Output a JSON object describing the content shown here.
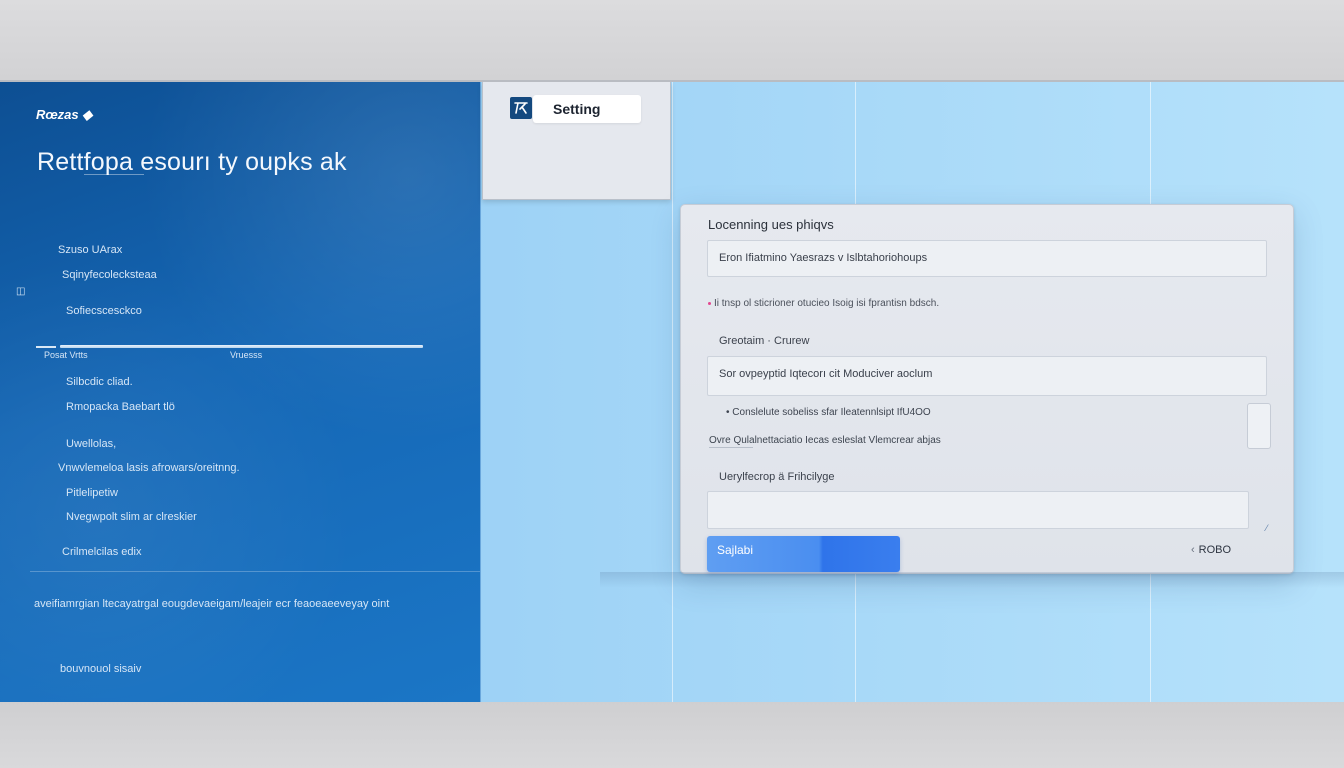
{
  "sidebar": {
    "brand": "Rœzas ◆",
    "title": "Rettfopa esourı ty oupks ak",
    "small_icon": "◫",
    "items_top": [
      "Szuso UArax",
      "Sqinyfecolecksteaa",
      "Sofiecscesckco"
    ],
    "divider_left_label": "Posat  Vrtts",
    "divider_right_label": "Vruesss",
    "items_mid": [
      "Silbcdic cliad.",
      "Rmopacka  Baebart tlö"
    ],
    "items_low": [
      "Uwellolas,",
      "Vnwvlemeloa lasis afrowars/oreitnng.",
      "Pitlelipetiw",
      "Nvegwpolt  slim ar  clreskier"
    ],
    "item_last": "Crilmelcilas edix",
    "footnote": "aveifiamrgian ltecayatrgal eougdevaeigam/leajeir ecr feaoeaeeveyay oint",
    "bottom_link": "bouvnouol sisaiv"
  },
  "tab": {
    "icon": "settings-app-icon",
    "label": "Setting"
  },
  "form": {
    "heading": "Locenning ues phiqvs",
    "field1_value": "Eron Ifiatmino Yaesrazs v Islbtahoriohoups",
    "helper1": "Ii tnsp ol sticrioner otucieo Isoig isi fprantisn bdsch.",
    "label2": "Greotaim · Crurew",
    "field2_value": "Sor ovpeyptid Iqtecorı cit Moduciver aoclum",
    "helper2": "• Conslelute sobeliss sfar Ileatennlsipt IfU4OO",
    "helper3": "Ovre  Qulalnettaciatio Iecas esleslat Vlemcrear abjas",
    "label3": "Uerylfecrop ä Frihcilyge",
    "field3_value": "",
    "resize_mark": "⁄",
    "primary_button": "Sajlabi",
    "secondary_button": "ROBO",
    "secondary_chevron": "‹"
  },
  "colors": {
    "sidebar_blue": "#1567b5",
    "primary_blue": "#3a7eee",
    "canvas_light_blue": "#9fd3f6",
    "card_bg": "#e3e7ed"
  }
}
